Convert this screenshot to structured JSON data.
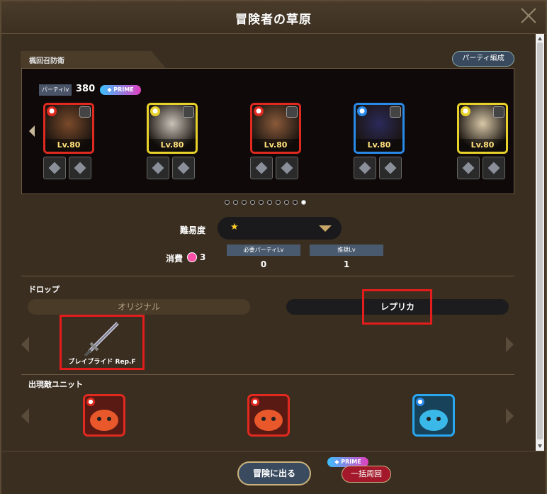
{
  "window": {
    "title": "冒険者の草原"
  },
  "party": {
    "header": "楓回召防衛",
    "form_button": "パーティ編成",
    "level_badge": "パーティlv",
    "level_value": "380",
    "prime_label": "PRIME",
    "units": [
      {
        "level": "Lv.80",
        "element_color": "#e02a20",
        "frame": "red",
        "face_color": "#7a4a2a",
        "equip": [
          "armor-icon",
          "orb-icon"
        ]
      },
      {
        "level": "Lv.80",
        "element_color": "#e8d12a",
        "frame": "yellow",
        "face_color": "#c9c2b8",
        "equip": [
          "chest-icon",
          "gauntlet-icon"
        ]
      },
      {
        "level": "Lv.80",
        "element_color": "#e02a20",
        "frame": "red",
        "face_color": "#8a5a3a",
        "equip": [
          "sword-icon",
          "axe-icon"
        ]
      },
      {
        "level": "Lv.80",
        "element_color": "#2a8ae8",
        "frame": "blue",
        "face_color": "#2b2a5a",
        "equip": [
          "bird-icon",
          "bird-icon"
        ]
      },
      {
        "level": "Lv.80",
        "element_color": "#e8d12a",
        "frame": "yellow",
        "face_color": "#d8c8a8",
        "equip": [
          "axe-icon",
          "sword-icon"
        ]
      }
    ],
    "page_count": 10,
    "active_page": 10
  },
  "difficulty": {
    "label": "難易度",
    "value": "★"
  },
  "cost": {
    "label": "消費",
    "value": "3",
    "required_label": "必要パーティLv",
    "required_value": "0",
    "recommended_label": "推奨Lv",
    "recommended_value": "1"
  },
  "drop": {
    "label": "ドロップ",
    "tabs": [
      "オリジナル",
      "レプリカ"
    ],
    "selected_tab": "レプリカ",
    "items": [
      {
        "name": "ブレイブライド Rep.F"
      }
    ]
  },
  "enemies": {
    "label": "出現敵ユニット",
    "units": [
      {
        "frame": "red",
        "color": "#e8582a"
      },
      {
        "frame": "red",
        "color": "#e8582a"
      },
      {
        "frame": "blue",
        "color": "#3ab8e8"
      }
    ]
  },
  "footer": {
    "depart_button": "冒険に出る",
    "bulk_button": "一括周回",
    "prime_label": "PRIME"
  }
}
